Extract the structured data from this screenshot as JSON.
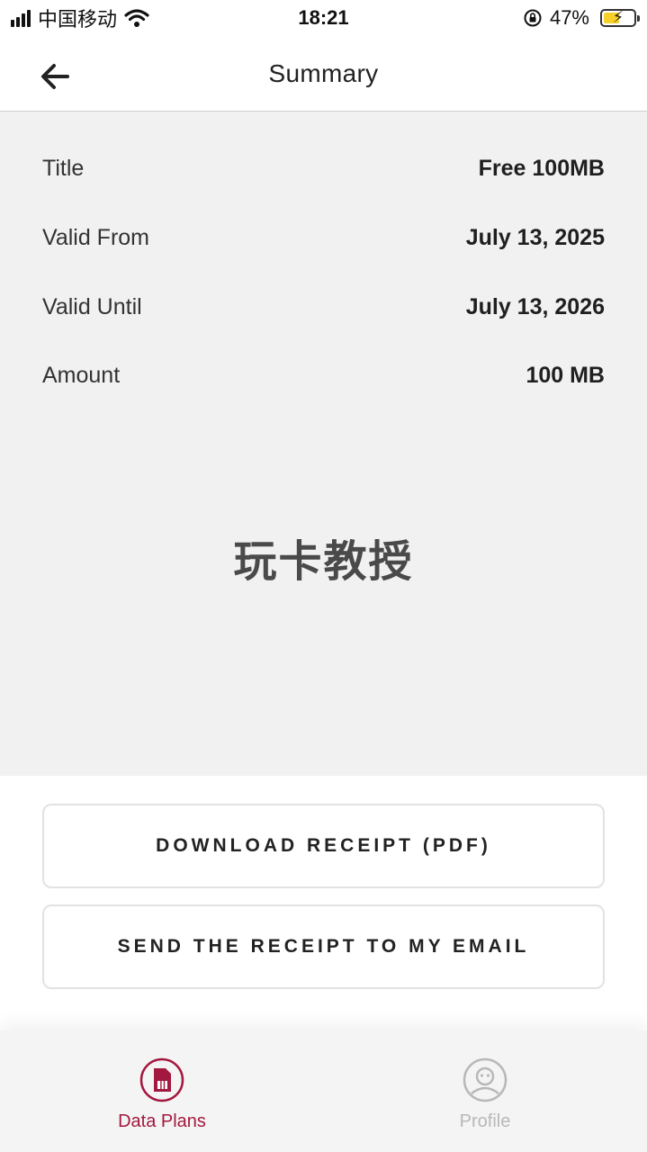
{
  "status_bar": {
    "carrier": "中国移动",
    "time": "18:21",
    "battery": "47%"
  },
  "header": {
    "title": "Summary"
  },
  "summary": {
    "rows": [
      {
        "label": "Title",
        "value": "Free 100MB"
      },
      {
        "label": "Valid From",
        "value": "July 13, 2025"
      },
      {
        "label": "Valid Until",
        "value": "July 13, 2026"
      },
      {
        "label": "Amount",
        "value": "100 MB"
      }
    ]
  },
  "watermark": "玩卡教授",
  "actions": {
    "download_label": "DOWNLOAD RECEIPT (PDF)",
    "email_label": "SEND THE RECEIPT TO MY EMAIL"
  },
  "nav": {
    "items": [
      {
        "label": "Data Plans",
        "icon": "sim-card-icon",
        "active": true
      },
      {
        "label": "Profile",
        "icon": "profile-icon",
        "active": false
      }
    ]
  },
  "colors": {
    "accent": "#a3183f",
    "inactive": "#b8b8b8",
    "content_bg": "#f1f1f1"
  }
}
